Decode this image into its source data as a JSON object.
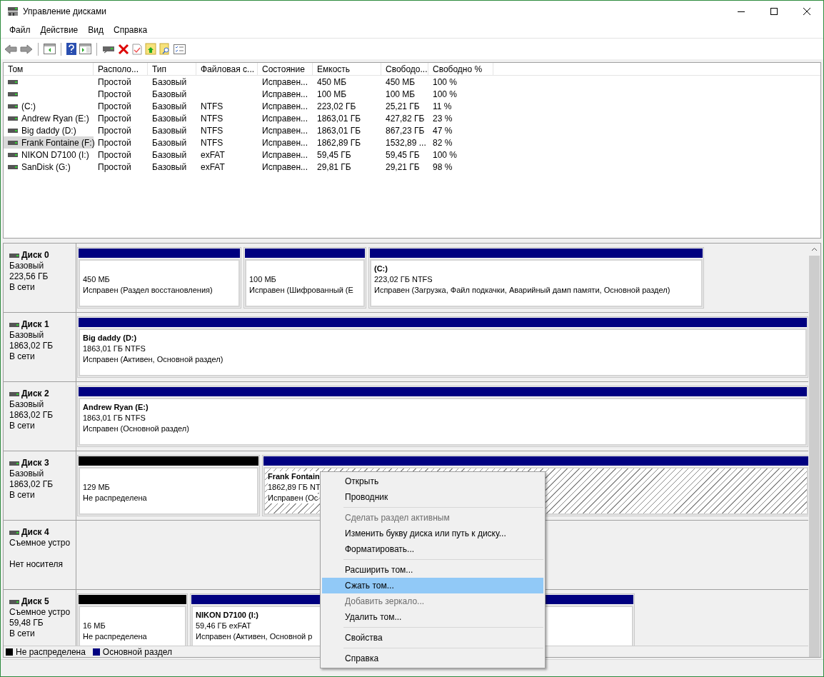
{
  "window": {
    "title": "Управление дисками"
  },
  "menu_bar": [
    "Файл",
    "Действие",
    "Вид",
    "Справка"
  ],
  "volume_table": {
    "columns": [
      "Том",
      "Располо...",
      "Тип",
      "Файловая с...",
      "Состояние",
      "Емкость",
      "Свободо...",
      "Свободно %"
    ],
    "rows": [
      {
        "selected": false,
        "cells": [
          "",
          "Простой",
          "Базовый",
          "",
          "Исправен...",
          "450 МБ",
          "450 МБ",
          "100 %"
        ]
      },
      {
        "selected": false,
        "cells": [
          "",
          "Простой",
          "Базовый",
          "",
          "Исправен...",
          "100 МБ",
          "100 МБ",
          "100 %"
        ]
      },
      {
        "selected": false,
        "cells": [
          "(C:)",
          "Простой",
          "Базовый",
          "NTFS",
          "Исправен...",
          "223,02 ГБ",
          "25,21 ГБ",
          "11 %"
        ]
      },
      {
        "selected": false,
        "cells": [
          "Andrew Ryan (E:)",
          "Простой",
          "Базовый",
          "NTFS",
          "Исправен...",
          "1863,01 ГБ",
          "427,82 ГБ",
          "23 %"
        ]
      },
      {
        "selected": false,
        "cells": [
          "Big daddy (D:)",
          "Простой",
          "Базовый",
          "NTFS",
          "Исправен...",
          "1863,01 ГБ",
          "867,23 ГБ",
          "47 %"
        ]
      },
      {
        "selected": true,
        "cells": [
          "Frank Fontaine (F:)",
          "Простой",
          "Базовый",
          "NTFS",
          "Исправен...",
          "1862,89 ГБ",
          "1532,89 ...",
          "82 %"
        ]
      },
      {
        "selected": false,
        "cells": [
          "NIKON D7100 (I:)",
          "Простой",
          "Базовый",
          "exFAT",
          "Исправен...",
          "59,45 ГБ",
          "59,45 ГБ",
          "100 %"
        ]
      },
      {
        "selected": false,
        "cells": [
          "SanDisk (G:)",
          "Простой",
          "Базовый",
          "exFAT",
          "Исправен...",
          "29,81 ГБ",
          "29,21 ГБ",
          "98 %"
        ]
      }
    ]
  },
  "disks": [
    {
      "name": "Диск 0",
      "type": "Базовый",
      "size": "223,56 ГБ",
      "status": "В сети",
      "partitions": [
        {
          "kind": "primary",
          "selected": false,
          "lines": [
            "450 МБ",
            "Исправен (Раздел восстановления)"
          ]
        },
        {
          "kind": "primary",
          "selected": false,
          "lines": [
            "100 МБ",
            "Исправен (Шифрованный (E"
          ]
        },
        {
          "kind": "primary",
          "selected": false,
          "label": "(C:)",
          "lines": [
            "223,02 ГБ NTFS",
            "Исправен (Загрузка, Файл подкачки, Аварийный дамп памяти, Основной раздел)"
          ]
        }
      ]
    },
    {
      "name": "Диск 1",
      "type": "Базовый",
      "size": "1863,02 ГБ",
      "status": "В сети",
      "partitions": [
        {
          "kind": "primary",
          "selected": false,
          "label": "Big daddy  (D:)",
          "lines": [
            "1863,01 ГБ NTFS",
            "Исправен (Активен, Основной раздел)"
          ]
        }
      ]
    },
    {
      "name": "Диск 2",
      "type": "Базовый",
      "size": "1863,02 ГБ",
      "status": "В сети",
      "partitions": [
        {
          "kind": "primary",
          "selected": false,
          "label": "Andrew Ryan  (E:)",
          "lines": [
            "1863,01 ГБ NTFS",
            "Исправен (Основной раздел)"
          ]
        }
      ]
    },
    {
      "name": "Диск 3",
      "type": "Базовый",
      "size": "1863,02 ГБ",
      "status": "В сети",
      "partitions": [
        {
          "kind": "unallocated",
          "selected": false,
          "lines": [
            "129 МБ",
            "Не распределена"
          ]
        },
        {
          "kind": "primary",
          "selected": true,
          "label": "Frank Fontain",
          "lines": [
            "1862,89 ГБ NT",
            "Исправен (Ос"
          ]
        }
      ]
    },
    {
      "name": "Диск 4",
      "type": "Съемное устро",
      "status": "Нет носителя"
    },
    {
      "name": "Диск 5",
      "type": "Съемное устро",
      "size": "59,48 ГБ",
      "status": "В сети",
      "partitions": [
        {
          "kind": "unallocated",
          "selected": false,
          "lines": [
            "16 МБ",
            "Не распределена"
          ]
        },
        {
          "kind": "primary",
          "selected": false,
          "label": "NIKON D7100  (I:)",
          "lines": [
            "59,46 ГБ exFAT",
            "Исправен (Активен, Основной р"
          ]
        }
      ]
    }
  ],
  "legend": [
    {
      "label": "Не распределена",
      "color": "#000000"
    },
    {
      "label": "Основной раздел",
      "color": "#000080"
    }
  ],
  "context_menu": [
    {
      "kind": "item",
      "label": "Открыть",
      "disabled": false,
      "selected": false
    },
    {
      "kind": "item",
      "label": "Проводник",
      "disabled": false,
      "selected": false
    },
    {
      "kind": "separator"
    },
    {
      "kind": "item",
      "label": "Сделать раздел активным",
      "disabled": true,
      "selected": false
    },
    {
      "kind": "item",
      "label": "Изменить букву диска или путь к диску...",
      "disabled": false,
      "selected": false
    },
    {
      "kind": "item",
      "label": "Форматировать...",
      "disabled": false,
      "selected": false
    },
    {
      "kind": "separator"
    },
    {
      "kind": "item",
      "label": "Расширить том...",
      "disabled": false,
      "selected": false
    },
    {
      "kind": "item",
      "label": "Сжать том...",
      "disabled": false,
      "selected": true
    },
    {
      "kind": "item",
      "label": "Добавить зеркало...",
      "disabled": true,
      "selected": false
    },
    {
      "kind": "item",
      "label": "Удалить том...",
      "disabled": false,
      "selected": false
    },
    {
      "kind": "separator"
    },
    {
      "kind": "item",
      "label": "Свойства",
      "disabled": false,
      "selected": false
    },
    {
      "kind": "separator"
    },
    {
      "kind": "item",
      "label": "Справка",
      "disabled": false,
      "selected": false
    }
  ]
}
